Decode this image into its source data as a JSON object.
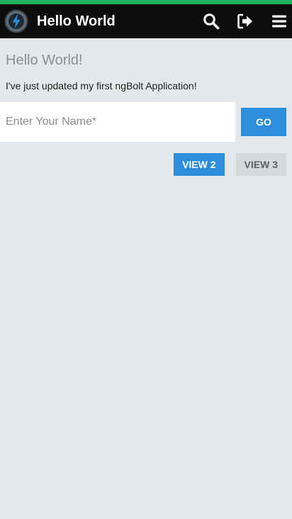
{
  "colors": {
    "accent_line": "#21b05a",
    "appbar_bg": "#0d0d0d",
    "primary": "#2d8fdc",
    "secondary_btn": "#d5d9dc",
    "page_bg": "#e4e8ea"
  },
  "appbar": {
    "logo_icon": "bolt-logo-icon",
    "title": "Hello World",
    "actions": [
      {
        "icon": "search-icon"
      },
      {
        "icon": "sign-out-icon"
      },
      {
        "icon": "hamburger-menu-icon"
      }
    ]
  },
  "main": {
    "heading": "Hello World!",
    "message": "I've just updated my first ngBolt Application!",
    "name_input": {
      "placeholder": "Enter Your Name*",
      "value": ""
    },
    "go_label": "GO",
    "view2_label": "VIEW 2",
    "view3_label": "VIEW 3"
  }
}
